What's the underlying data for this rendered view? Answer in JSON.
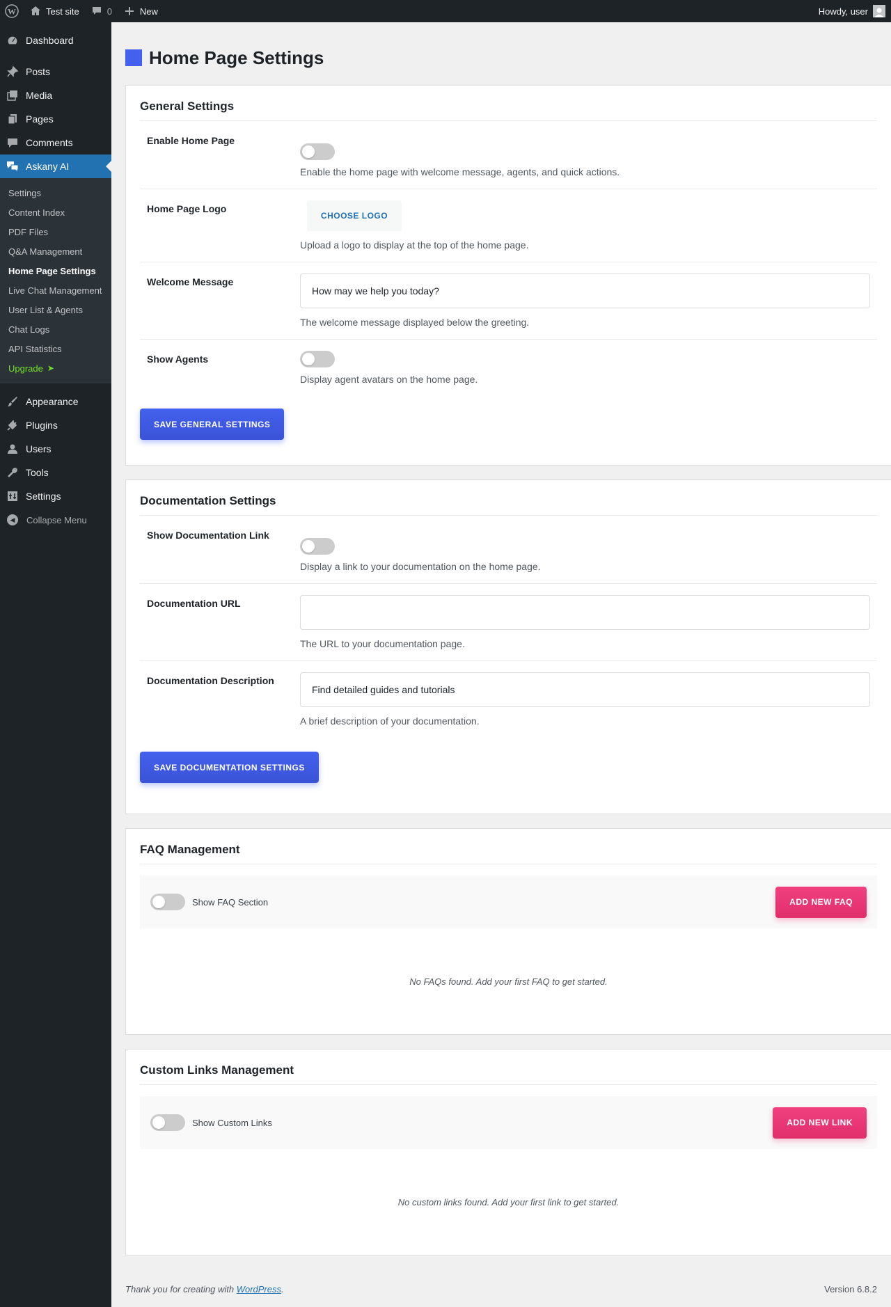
{
  "adminbar": {
    "site_name": "Test site",
    "comments_count": "0",
    "new_label": "New",
    "howdy": "Howdy, user"
  },
  "sidebar": {
    "items_top": [
      {
        "label": "Dashboard",
        "icon": "dashboard-icon"
      },
      {
        "label": "Posts",
        "icon": "pin-icon"
      },
      {
        "label": "Media",
        "icon": "media-icon"
      },
      {
        "label": "Pages",
        "icon": "pages-icon"
      },
      {
        "label": "Comments",
        "icon": "comment-icon"
      },
      {
        "label": "Askany AI",
        "icon": "chat-icon"
      }
    ],
    "submenu": [
      "Settings",
      "Content Index",
      "PDF Files",
      "Q&A Management",
      "Home Page Settings",
      "Live Chat Management",
      "User List & Agents",
      "Chat Logs",
      "API Statistics",
      "Upgrade"
    ],
    "upgrade_arrow": "➤",
    "items_bottom": [
      {
        "label": "Appearance",
        "icon": "brush-icon"
      },
      {
        "label": "Plugins",
        "icon": "plug-icon"
      },
      {
        "label": "Users",
        "icon": "user-icon"
      },
      {
        "label": "Tools",
        "icon": "wrench-icon"
      },
      {
        "label": "Settings",
        "icon": "settings-icon"
      }
    ],
    "collapse_label": "Collapse Menu"
  },
  "page": {
    "title": "Home Page Settings",
    "accent_color": "#4361ee"
  },
  "general": {
    "title": "General Settings",
    "enable_label": "Enable Home Page",
    "enable_desc": "Enable the home page with welcome message, agents, and quick actions.",
    "logo_label": "Home Page Logo",
    "logo_button": "CHOOSE LOGO",
    "logo_desc": "Upload a logo to display at the top of the home page.",
    "welcome_label": "Welcome Message",
    "welcome_value": "How may we help you today?",
    "welcome_desc": "The welcome message displayed below the greeting.",
    "agents_label": "Show Agents",
    "agents_desc": "Display agent avatars on the home page.",
    "save_button": "SAVE GENERAL SETTINGS"
  },
  "documentation": {
    "title": "Documentation Settings",
    "show_label": "Show Documentation Link",
    "show_desc": "Display a link to your documentation on the home page.",
    "url_label": "Documentation URL",
    "url_value": "",
    "url_desc": "The URL to your documentation page.",
    "descr_label": "Documentation Description",
    "descr_value": "Find detailed guides and tutorials",
    "descr_desc": "A brief description of your documentation.",
    "save_button": "SAVE DOCUMENTATION SETTINGS"
  },
  "faq": {
    "title": "FAQ Management",
    "toggle_label": "Show FAQ Section",
    "add_button": "ADD NEW FAQ",
    "empty": "No FAQs found. Add your first FAQ to get started."
  },
  "links": {
    "title": "Custom Links Management",
    "toggle_label": "Show Custom Links",
    "add_button": "ADD NEW LINK",
    "empty": "No custom links found. Add your first link to get started."
  },
  "footer": {
    "text_before": "Thank you for creating with ",
    "link": "WordPress",
    "text_after": ".",
    "version": "Version 6.8.2"
  }
}
